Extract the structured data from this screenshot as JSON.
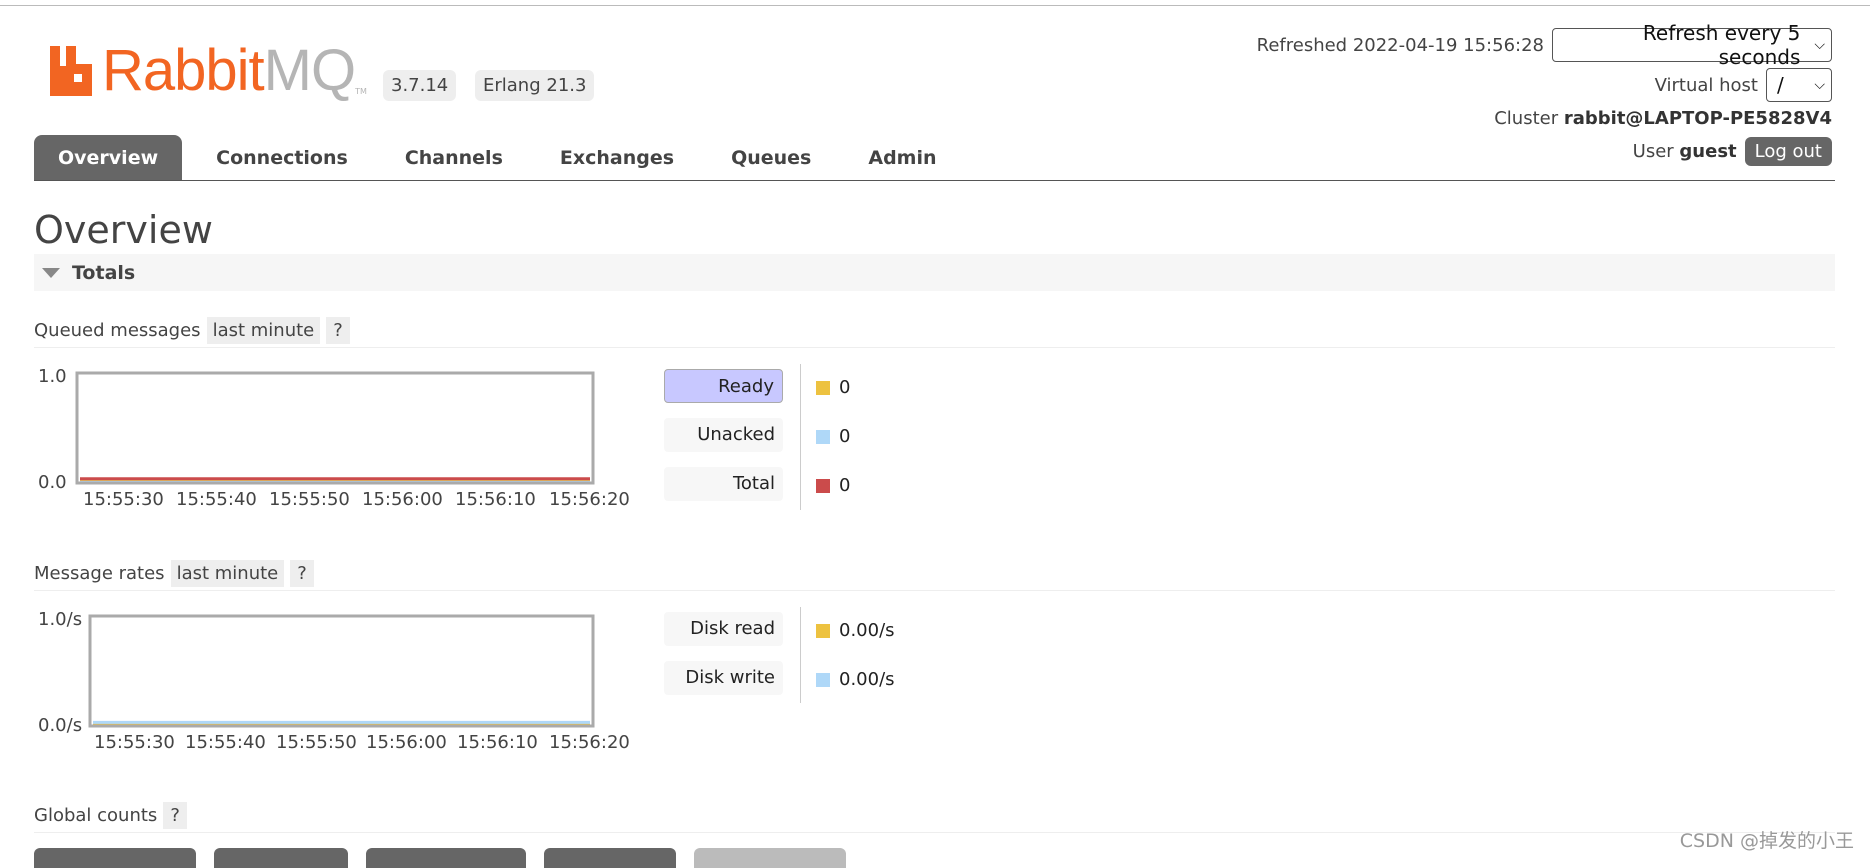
{
  "colors": {
    "accent": "#f26522",
    "ready": "#edc240",
    "unacked": "#afd8f8",
    "total": "#cb4b4b",
    "tab_active": "#666666"
  },
  "header": {
    "logo_icon": "rabbitmq-logo-icon",
    "logo_rabbit": "Rabbit",
    "logo_mq": "MQ",
    "logo_tm": "TM",
    "version": "3.7.14",
    "erlang": "Erlang 21.3",
    "refreshed_label": "Refreshed 2022-04-19 15:56:28",
    "refresh_select": "Refresh every 5 seconds",
    "vhost_label": "Virtual host",
    "vhost_value": "/",
    "cluster_label": "Cluster",
    "cluster_value": "rabbit@LAPTOP-PE5828V4",
    "user_label": "User",
    "user_value": "guest",
    "logout": "Log out"
  },
  "tabs": [
    {
      "label": "Overview"
    },
    {
      "label": "Connections"
    },
    {
      "label": "Channels"
    },
    {
      "label": "Exchanges"
    },
    {
      "label": "Queues"
    },
    {
      "label": "Admin"
    }
  ],
  "page": {
    "title": "Overview",
    "totals_section": "Totals",
    "queued": {
      "label": "Queued messages",
      "range": "last minute",
      "help": "?"
    },
    "rates": {
      "label": "Message rates",
      "range": "last minute",
      "help": "?"
    },
    "global": {
      "label": "Global counts",
      "help": "?"
    }
  },
  "queued_legend": [
    {
      "label": "Ready",
      "value": "0",
      "color": "#edc240"
    },
    {
      "label": "Unacked",
      "value": "0",
      "color": "#afd8f8"
    },
    {
      "label": "Total",
      "value": "0",
      "color": "#cb4b4b"
    }
  ],
  "rates_legend": [
    {
      "label": "Disk read",
      "value": "0.00/s",
      "color": "#edc240"
    },
    {
      "label": "Disk write",
      "value": "0.00/s",
      "color": "#afd8f8"
    }
  ],
  "chart_data": [
    {
      "type": "line",
      "title": "Queued messages",
      "x": [
        "15:55:30",
        "15:55:40",
        "15:55:50",
        "15:56:00",
        "15:56:10",
        "15:56:20"
      ],
      "y_ticks": [
        "1.0",
        "0.0"
      ],
      "ylim": [
        0,
        1
      ],
      "series": [
        {
          "name": "Ready",
          "values": [
            0,
            0,
            0,
            0,
            0,
            0
          ]
        },
        {
          "name": "Unacked",
          "values": [
            0,
            0,
            0,
            0,
            0,
            0
          ]
        },
        {
          "name": "Total",
          "values": [
            0,
            0,
            0,
            0,
            0,
            0
          ]
        }
      ]
    },
    {
      "type": "line",
      "title": "Message rates",
      "x": [
        "15:55:30",
        "15:55:40",
        "15:55:50",
        "15:56:00",
        "15:56:10",
        "15:56:20"
      ],
      "y_ticks": [
        "1.0/s",
        "0.0/s"
      ],
      "ylim": [
        0,
        1
      ],
      "series": [
        {
          "name": "Disk read",
          "values": [
            0,
            0,
            0,
            0,
            0,
            0
          ]
        },
        {
          "name": "Disk write",
          "values": [
            0,
            0,
            0,
            0,
            0,
            0
          ]
        }
      ]
    }
  ],
  "watermark": "CSDN @掉发的小王"
}
